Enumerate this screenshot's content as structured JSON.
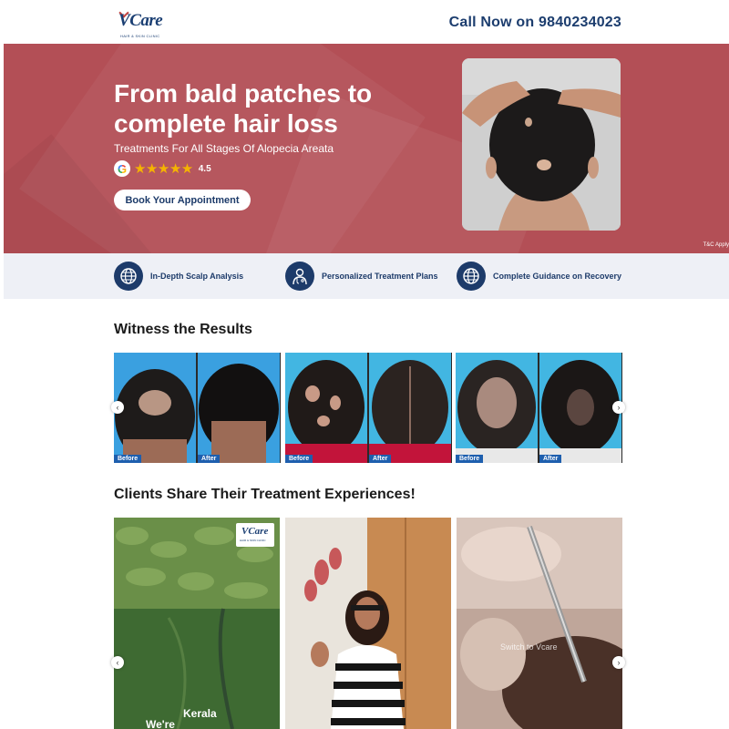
{
  "header": {
    "logo_text": "Care",
    "logo_subtitle": "HAIR & SKIN CLINIC",
    "call_text": "Call Now on 9840234023"
  },
  "hero": {
    "title": "From bald patches to complete hair loss",
    "subtitle": "Treatments For All Stages Of Alopecia Areata",
    "rating_value": "4.5",
    "stars": "★★★★★",
    "book_button": "Book Your Appointment",
    "terms": "T&C Apply"
  },
  "features": [
    {
      "label": "In-Depth Scalp Analysis",
      "icon": "globe-icon"
    },
    {
      "label": "Personalized Treatment Plans",
      "icon": "doctor-icon"
    },
    {
      "label": "Complete Guidance on Recovery",
      "icon": "globe-icon"
    }
  ],
  "results": {
    "title": "Witness the Results",
    "before_label": "Before",
    "after_label": "After"
  },
  "testimonials": {
    "title": "Clients Share Their Treatment Experiences!",
    "video1_text_a": "Kerala",
    "video1_text_b": "We're",
    "video3_overlay": "Switch to Vcare"
  },
  "colors": {
    "brand_navy": "#1d3b6a",
    "hero_red": "#b34f56",
    "tag_blue": "#1e5fae",
    "star_gold": "#f5b301"
  }
}
